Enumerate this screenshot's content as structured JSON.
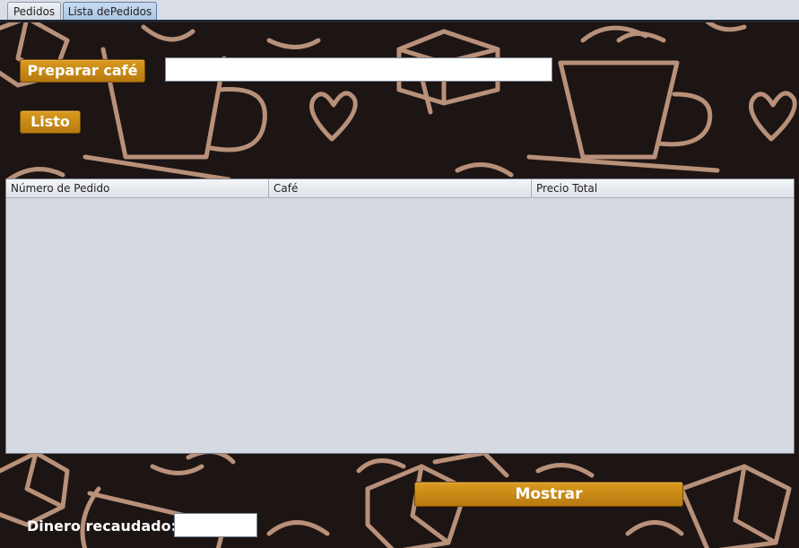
{
  "tabs": [
    {
      "label": "Pedidos",
      "active": false
    },
    {
      "label": "Lista dePedidos",
      "active": true
    }
  ],
  "controls": {
    "prepare_button": "Preparar café",
    "prepare_input_value": "",
    "ready_button": "Listo",
    "show_button": "Mostrar",
    "money_label": "Dinero recaudado:",
    "money_value": ""
  },
  "table": {
    "columns": [
      "Número de Pedido",
      "Café",
      "Precio Total"
    ],
    "rows": []
  },
  "colors": {
    "button_gold": "#c8860f",
    "panel_background": "#1c1514",
    "pattern_stroke": "#b99079",
    "table_background": "#d5d9e2"
  }
}
